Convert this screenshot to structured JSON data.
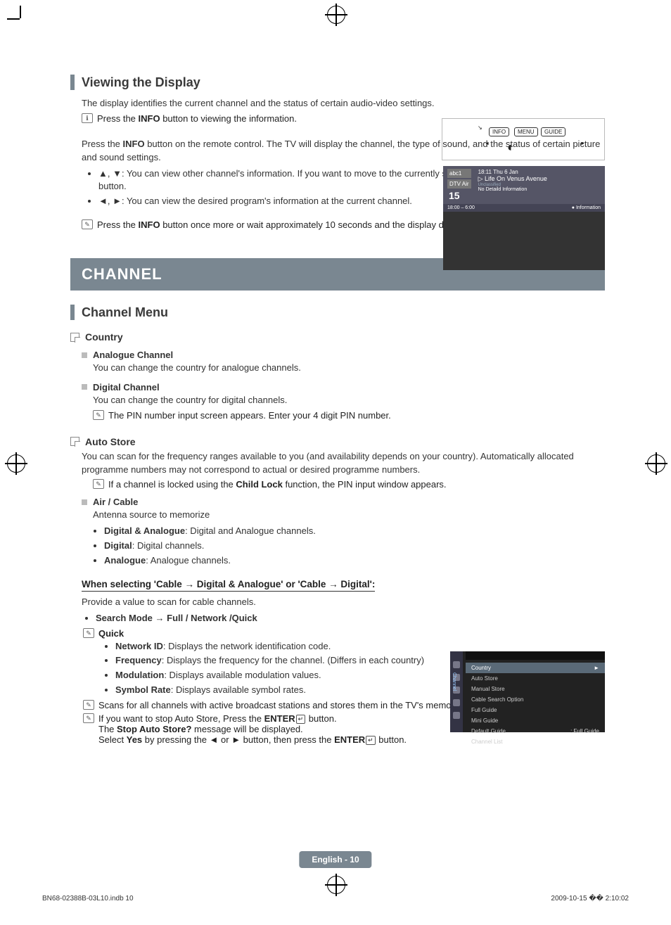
{
  "section1": {
    "title": "Viewing the Display",
    "intro": "The display identifies the current channel and the status of certain audio-video settings.",
    "press_info": "Press the <b>INFO</b> button to viewing the information.",
    "press_info2": "Press the <b>INFO</b> button on the remote control. The TV will display the channel, the type of sound, and the status of certain picture and sound settings.",
    "bullets": [
      "▲, ▼: You can view other channel's information. If you want to move to the currently selected channel, press <b>ENTER</b><span class='enter-icon'>↵</span> button.",
      "◄, ►: You can view the desired program's information at the current channel."
    ],
    "note": "Press the <b>INFO</b> button once more or wait approximately 10 seconds and the display disappears automatically."
  },
  "band": "CHANNEL",
  "section2": {
    "title": "Channel Menu",
    "country": {
      "heading": "Country",
      "analogue_h": "Analogue Channel",
      "analogue_t": "You can change the country for analogue channels.",
      "digital_h": "Digital Channel",
      "digital_t": "You can change the country for digital channels.",
      "digital_note": "The PIN number input screen appears. Enter your 4 digit PIN number."
    },
    "auto": {
      "heading": "Auto Store",
      "intro": "You can scan for the frequency ranges available to you (and availability depends on your country). Automatically allocated programme numbers may not correspond to actual or desired programme numbers.",
      "note1": "If a channel is locked using the <b>Child Lock</b> function, the PIN input window appears.",
      "air_h": "Air / Cable",
      "air_t": "Antenna source to memorize",
      "air_bullets": [
        "<b>Digital & Analogue</b>: Digital and Analogue channels.",
        "<b>Digital</b>: Digital channels.",
        "<b>Analogue</b>: Analogue channels."
      ],
      "cable_heading": "When selecting 'Cable → Digital & Analogue' or 'Cable → Digital':",
      "cable_sub": "Provide a value to scan for cable channels.",
      "search_mode": "<b>Search Mode → Full / Network /Quick</b>",
      "quick": "Quick",
      "quick_bullets": [
        "<b>Network ID</b>: Displays the network identification code.",
        "<b>Frequency</b>: Displays the frequency for the channel. (Differs in each country)",
        "<b>Modulation</b>: Displays available modulation values.",
        "<b>Symbol Rate</b>: Displays available symbol rates."
      ],
      "note2": "Scans for all channels with active broadcast stations and stores them in the TV's memory.",
      "note3": "If you want to stop Auto Store, Press the <b>ENTER</b><span class='enter-icon'>↵</span> button.",
      "note3b": "The <b>Stop Auto Store?</b> message will be displayed.",
      "note3c": "Select <b>Yes</b> by pressing the ◄ or ► button, then press the <b>ENTER</b><span class='enter-icon'>↵</span> button."
    }
  },
  "remote": {
    "b1": "INFO",
    "b2": "MENU",
    "b3": "GUIDE"
  },
  "osd": {
    "ch1": "abc1",
    "ch2": "DTV Air",
    "chnum": "15",
    "time": "18:11 Thu 6 Jan",
    "prog": "Life On Venus Avenue",
    "cls": "Unclassified",
    "nd": "No Detaild Information",
    "span": "18:00 – 6:00",
    "info": "● Information"
  },
  "menu": {
    "side": "Channel",
    "items": [
      "Country",
      "Auto Store",
      "Manual Store",
      "Cable Search Option",
      "Full Guide",
      "Mini Guide",
      "Default Guide",
      "Channel List"
    ],
    "right": ": Full Guide",
    "tri": "►"
  },
  "footer": {
    "center": "English - 10",
    "left": "BN68-02388B-03L10.indb   10",
    "right": "2009-10-15   �� 2:10:02"
  }
}
